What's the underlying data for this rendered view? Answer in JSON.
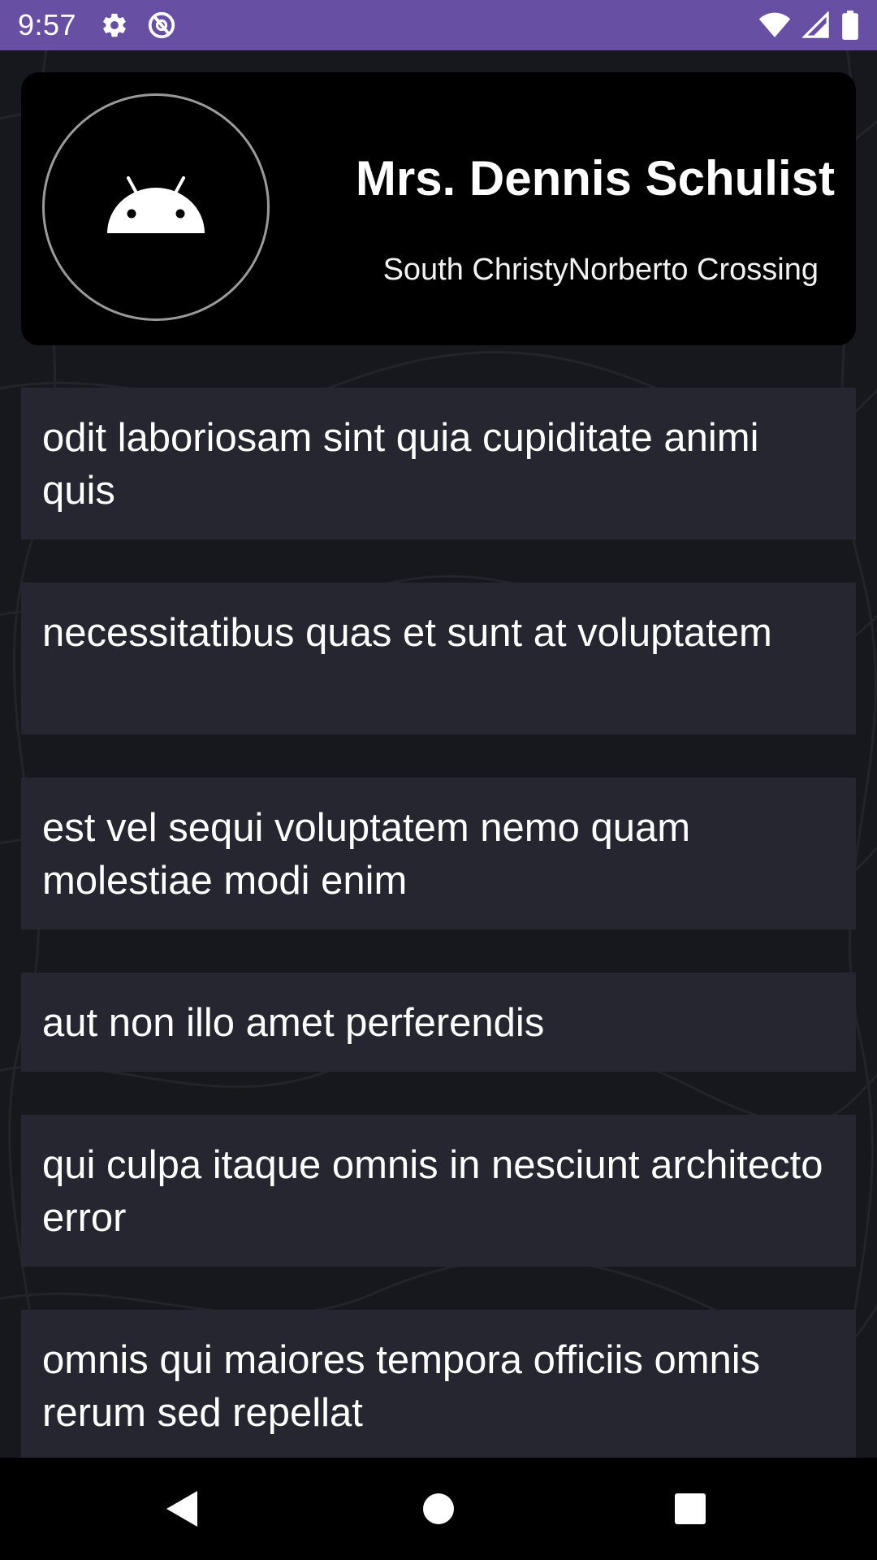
{
  "status_bar": {
    "time": "9:57",
    "left_icons": [
      "gear-icon",
      "data-saver-icon"
    ],
    "right_icons": [
      "wifi-icon",
      "cell-signal-icon",
      "battery-icon"
    ],
    "background": "#6750a4"
  },
  "profile": {
    "name": "Mrs. Dennis Schulist",
    "location": "South ChristyNorberto Crossing",
    "avatar_icon": "android-icon"
  },
  "list": {
    "items": [
      {
        "text": "odit laboriosam sint quia cupiditate animi quis"
      },
      {
        "text": "necessitatibus quas et sunt at voluptatem"
      },
      {
        "text": "est vel sequi voluptatem nemo quam molestiae modi enim"
      },
      {
        "text": "aut non illo amet perferendis"
      },
      {
        "text": "qui culpa itaque omnis in nesciunt architecto error"
      },
      {
        "text": "omnis qui maiores tempora officiis omnis rerum sed repellat"
      }
    ]
  },
  "nav_bar": {
    "buttons": [
      "back-icon",
      "home-icon",
      "recents-icon"
    ]
  },
  "colors": {
    "background": "#17181d",
    "card": "#000000",
    "list_item": "#25262f",
    "accent": "#6750a4"
  }
}
